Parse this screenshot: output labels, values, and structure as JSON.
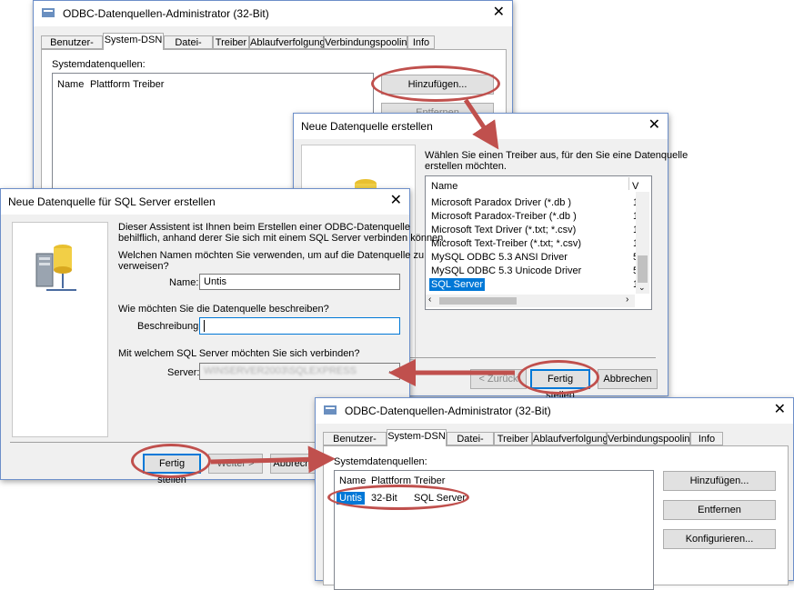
{
  "win1": {
    "title": "ODBC-Datenquellen-Administrator (32-Bit)",
    "tabs": [
      "Benutzer-DSN",
      "System-DSN",
      "Datei-DSN",
      "Treiber",
      "Ablaufverfolgung",
      "Verbindungspooling",
      "Info"
    ],
    "section_label": "Systemdatenquellen:",
    "columns": [
      "Name",
      "Plattform",
      "Treiber"
    ],
    "add_button": "Hinzufügen...",
    "remove_button": "Entfernen"
  },
  "win2": {
    "title": "Neue Datenquelle erstellen",
    "instruction": "Wählen Sie einen Treiber aus, für den Sie eine Datenquelle erstellen möchten.",
    "columns": [
      "Name",
      "V"
    ],
    "drivers": [
      {
        "name": "Microsoft Paradox Driver (*.db )",
        "ver": "1"
      },
      {
        "name": "Microsoft Paradox-Treiber (*.db )",
        "ver": "1"
      },
      {
        "name": "Microsoft Text Driver (*.txt; *.csv)",
        "ver": "1"
      },
      {
        "name": "Microsoft Text-Treiber (*.txt; *.csv)",
        "ver": "1"
      },
      {
        "name": "MySQL ODBC 5.3 ANSI Driver",
        "ver": "5"
      },
      {
        "name": "MySQL ODBC 5.3 Unicode Driver",
        "ver": "5"
      },
      {
        "name": "SQL Server",
        "ver": "1"
      }
    ],
    "back_button": "< Zurück",
    "finish_button": "Fertig stellen",
    "cancel_button": "Abbrechen"
  },
  "win3": {
    "title": "Neue Datenquelle für SQL Server erstellen",
    "intro": [
      "Dieser Assistent ist Ihnen beim Erstellen einer ODBC-Datenquelle",
      "behilflich, anhand derer Sie sich mit einem SQL Server verbinden können."
    ],
    "name_question": [
      "Welchen Namen möchten Sie verwenden, um auf die Datenquelle zu",
      "verweisen?"
    ],
    "name_label": "Name:",
    "name_value": "Untis",
    "desc_question": "Wie möchten Sie die Datenquelle beschreiben?",
    "desc_label": "Beschreibung:",
    "desc_value": "",
    "server_question": "Mit welchem SQL Server möchten Sie sich verbinden?",
    "server_label": "Server:",
    "server_value": "WINSERVER2003\\SQLEXPRESS",
    "finish_button": "Fertig stellen",
    "next_button": "Weiter >",
    "cancel_button": "Abbrechen"
  },
  "win4": {
    "title": "ODBC-Datenquellen-Administrator (32-Bit)",
    "tabs": [
      "Benutzer-DSN",
      "System-DSN",
      "Datei-DSN",
      "Treiber",
      "Ablaufverfolgung",
      "Verbindungspooling",
      "Info"
    ],
    "section_label": "Systemdatenquellen:",
    "columns": [
      "Name",
      "Plattform",
      "Treiber"
    ],
    "rows": [
      {
        "name": "Untis",
        "platform": "32-Bit",
        "driver": "SQL Server"
      }
    ],
    "add_button": "Hinzufügen...",
    "remove_button": "Entfernen",
    "configure_button": "Konfigurieren..."
  },
  "colors": {
    "highlight_ring": "#c0504d",
    "arrow": "#c0504d",
    "selection": "#0078d7"
  }
}
